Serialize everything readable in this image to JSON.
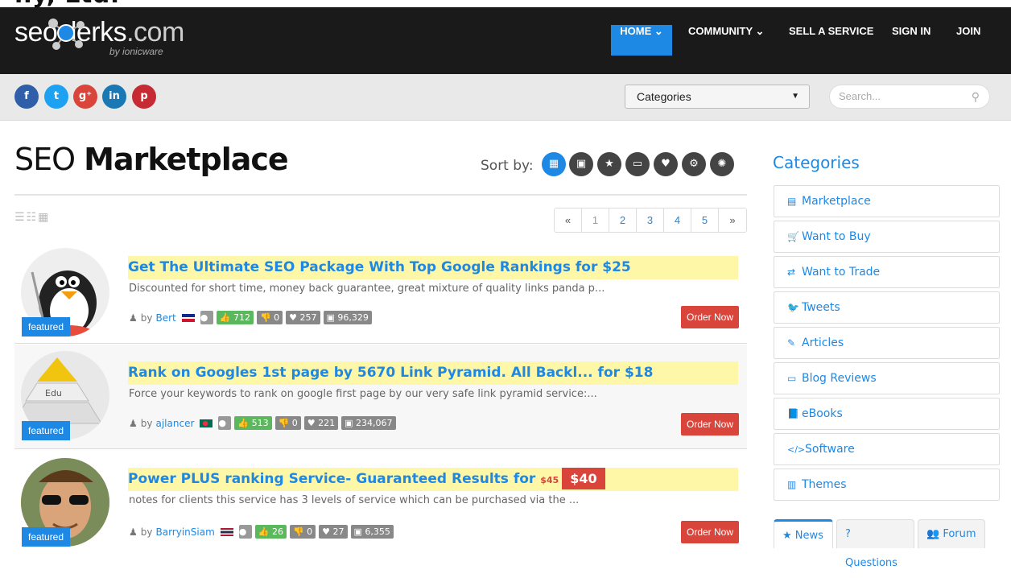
{
  "site": {
    "logo_word": "seoclerks",
    "logo_domain": ".com",
    "logo_by": "by ionicware",
    "top_crop_text": "ny, Ltd."
  },
  "nav": {
    "home": "HOME ⌄",
    "community": "COMMUNITY ⌄",
    "sell": "SELL A SERVICE",
    "signin": "SIGN IN",
    "join": "JOIN"
  },
  "subbar": {
    "social": {
      "facebook": "f",
      "twitter": "t",
      "googleplus": "g⁺",
      "linkedin": "in",
      "pinterest": "p"
    },
    "categories_select": "Categories",
    "search_placeholder": "Search..."
  },
  "main": {
    "title_light": "SEO ",
    "title_bold": "Marketplace",
    "sort_by": "Sort by:",
    "pagination": [
      "«",
      "1",
      "2",
      "3",
      "4",
      "5",
      "»"
    ],
    "listings": [
      {
        "badge": "featured",
        "title": "Get The Ultimate SEO Package With Top Google Rankings for $25",
        "description": "Discounted for short time, money back guarantee, great mixture of quality links panda p...",
        "by": "by",
        "user": "Bert",
        "likes": "712",
        "dislikes": "0",
        "favorites": "257",
        "views": "96,329",
        "order": "Order Now",
        "flag_colors": [
          "#0a2a8c",
          "#cf142b"
        ]
      },
      {
        "badge": "featured",
        "title": "Rank on Googles 1st page by 5670 Link Pyramid. All Backl... for $18",
        "description": "Force your keywords to rank on google first page by our very safe link pyramid service:...",
        "by": "by",
        "user": "ajlancer",
        "likes": "513",
        "dislikes": "0",
        "favorites": "221",
        "views": "234,067",
        "order": "Order Now",
        "flag_colors": [
          "#006a4e",
          "#f42a41"
        ]
      },
      {
        "badge": "featured",
        "title": "Power PLUS ranking Service- Guaranteed Results for ",
        "strike_price": "$45",
        "price": "$40",
        "description": "notes for clients this service has 3 levels of service which can be purchased via the ...",
        "by": "by",
        "user": "BarryinSiam",
        "likes": "26",
        "dislikes": "0",
        "favorites": "27",
        "views": "6,355",
        "order": "Order Now",
        "flag_colors": [
          "#2d2a4a",
          "#a51931"
        ]
      }
    ]
  },
  "sidebar": {
    "heading": "Categories",
    "items": [
      {
        "label": "Marketplace",
        "icon": "▤"
      },
      {
        "label": "Want to Buy",
        "icon": "🛒"
      },
      {
        "label": "Want to Trade",
        "icon": "⇄"
      },
      {
        "label": "Tweets",
        "icon": "🐦"
      },
      {
        "label": "Articles",
        "icon": "✎"
      },
      {
        "label": "Blog Reviews",
        "icon": "▭"
      },
      {
        "label": "eBooks",
        "icon": "📘"
      },
      {
        "label": "Software",
        "icon": "</>"
      },
      {
        "label": "Themes",
        "icon": "▥"
      }
    ],
    "tabs": [
      {
        "label": "News",
        "icon": "★"
      },
      {
        "label": "Questions",
        "icon": "?"
      },
      {
        "label": "Forum",
        "icon": "👥"
      }
    ]
  }
}
